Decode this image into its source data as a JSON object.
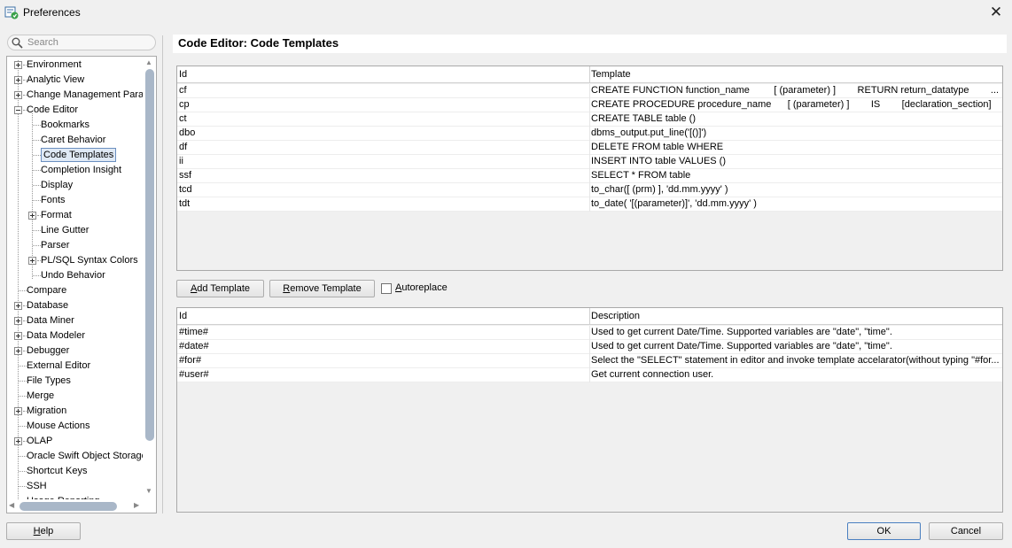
{
  "window": {
    "title": "Preferences",
    "close_icon": "close-icon"
  },
  "search": {
    "placeholder": "Search"
  },
  "tree": {
    "items": [
      {
        "label": "Environment",
        "level": 0,
        "expander": "plus"
      },
      {
        "label": "Analytic View",
        "level": 0,
        "expander": "plus"
      },
      {
        "label": "Change Management Parar",
        "level": 0,
        "expander": "plus"
      },
      {
        "label": "Code Editor",
        "level": 0,
        "expander": "minus"
      },
      {
        "label": "Bookmarks",
        "level": 1,
        "expander": "none"
      },
      {
        "label": "Caret Behavior",
        "level": 1,
        "expander": "none"
      },
      {
        "label": "Code Templates",
        "level": 1,
        "expander": "none",
        "selected": true
      },
      {
        "label": "Completion Insight",
        "level": 1,
        "expander": "none"
      },
      {
        "label": "Display",
        "level": 1,
        "expander": "none"
      },
      {
        "label": "Fonts",
        "level": 1,
        "expander": "none"
      },
      {
        "label": "Format",
        "level": 1,
        "expander": "plus"
      },
      {
        "label": "Line Gutter",
        "level": 1,
        "expander": "none"
      },
      {
        "label": "Parser",
        "level": 1,
        "expander": "none"
      },
      {
        "label": "PL/SQL Syntax Colors",
        "level": 1,
        "expander": "plus"
      },
      {
        "label": "Undo Behavior",
        "level": 1,
        "expander": "none"
      },
      {
        "label": "Compare",
        "level": 0,
        "expander": "none"
      },
      {
        "label": "Database",
        "level": 0,
        "expander": "plus"
      },
      {
        "label": "Data Miner",
        "level": 0,
        "expander": "plus"
      },
      {
        "label": "Data Modeler",
        "level": 0,
        "expander": "plus"
      },
      {
        "label": "Debugger",
        "level": 0,
        "expander": "plus"
      },
      {
        "label": "External Editor",
        "level": 0,
        "expander": "none"
      },
      {
        "label": "File Types",
        "level": 0,
        "expander": "none"
      },
      {
        "label": "Merge",
        "level": 0,
        "expander": "none"
      },
      {
        "label": "Migration",
        "level": 0,
        "expander": "plus"
      },
      {
        "label": "Mouse Actions",
        "level": 0,
        "expander": "none"
      },
      {
        "label": "OLAP",
        "level": 0,
        "expander": "plus"
      },
      {
        "label": "Oracle Swift Object Storage",
        "level": 0,
        "expander": "none"
      },
      {
        "label": "Shortcut Keys",
        "level": 0,
        "expander": "none"
      },
      {
        "label": "SSH",
        "level": 0,
        "expander": "none"
      },
      {
        "label": "Usage Reporting",
        "level": 0,
        "expander": "none"
      }
    ]
  },
  "page": {
    "title": "Code Editor: Code Templates"
  },
  "templates": {
    "headers": [
      "Id",
      "Template"
    ],
    "rows": [
      [
        "cf",
        "CREATE FUNCTION function_name         [ (parameter) ]        RETURN return_datatype        ..."
      ],
      [
        "cp",
        "CREATE PROCEDURE procedure_name      [ (parameter) ]        IS        [declaration_section]     ..."
      ],
      [
        "ct",
        "CREATE TABLE table ()"
      ],
      [
        "dbo",
        "dbms_output.put_line('[()]')"
      ],
      [
        "df",
        "DELETE FROM table WHERE"
      ],
      [
        "ii",
        "INSERT INTO table VALUES ()"
      ],
      [
        "ssf",
        "SELECT * FROM table"
      ],
      [
        "tcd",
        "to_char([ (prm) ], 'dd.mm.yyyy' )"
      ],
      [
        "tdt",
        "to_date( '[(parameter)]', 'dd.mm.yyyy' )"
      ]
    ]
  },
  "buttons": {
    "add_template": {
      "mnemonic": "A",
      "rest": "dd Template"
    },
    "remove_template": {
      "mnemonic": "R",
      "rest": "emove Template"
    },
    "autoreplace": {
      "mnemonic": "A",
      "rest": "utoreplace"
    },
    "help": {
      "mnemonic": "H",
      "rest": "elp"
    },
    "ok": "OK",
    "cancel": "Cancel"
  },
  "variables": {
    "headers": [
      "Id",
      "Description"
    ],
    "rows": [
      [
        "#time#",
        "Used to get current Date/Time. Supported variables are \"date\", \"time\"."
      ],
      [
        "#date#",
        "Used to get current Date/Time. Supported variables are \"date\", \"time\"."
      ],
      [
        "#for#",
        "Select the \"SELECT\" statement in editor and invoke template accelarator(without typing \"#for..."
      ],
      [
        "#user#",
        "Get current connection user."
      ]
    ]
  },
  "autoreplace_checked": false
}
